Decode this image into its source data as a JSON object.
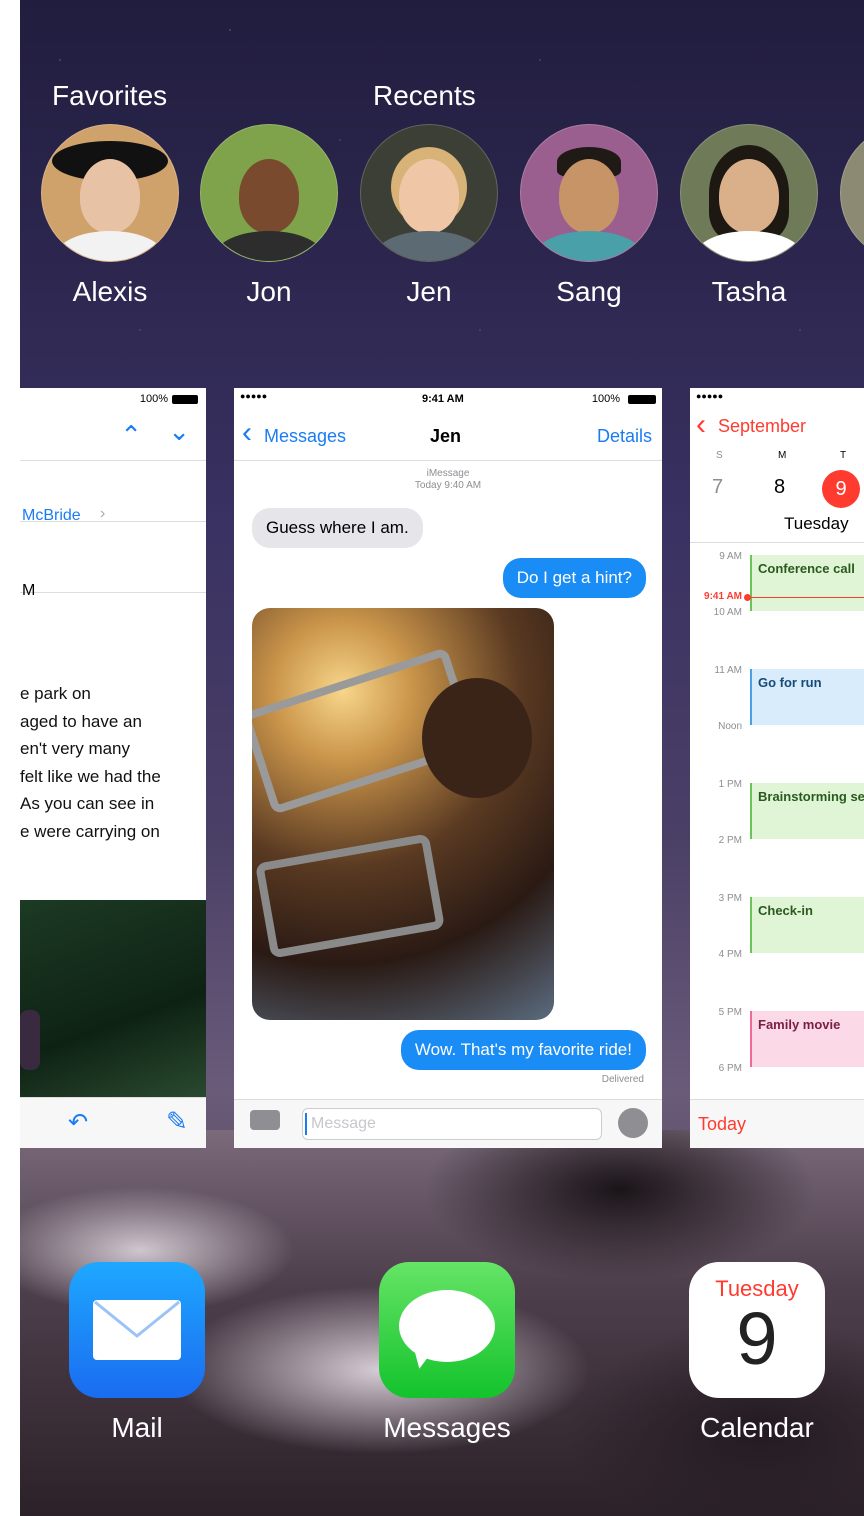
{
  "favorites_label": "Favorites",
  "recents_label": "Recents",
  "contacts": [
    {
      "name": "Alexis",
      "skin": "#e8c2a4",
      "hair": "#b07a3c",
      "bg": "#cfa26c",
      "shirt": "#f2f2f2"
    },
    {
      "name": "Jon",
      "skin": "#7a4a2e",
      "hair": "#2a1a12",
      "bg": "#7ea34a",
      "shirt": "#2d2d2d"
    },
    {
      "name": "Jen",
      "skin": "#efc7a6",
      "hair": "#d9b277",
      "bg": "#3c3f36",
      "shirt": "#5c6a74"
    },
    {
      "name": "Sang",
      "skin": "#c79468",
      "hair": "#1f1a16",
      "bg": "#9a5f8e",
      "shirt": "#4aa0a8"
    },
    {
      "name": "Tasha",
      "skin": "#d9b08a",
      "hair": "#1e1812",
      "bg": "#6f7a58",
      "shirt": "#ffffff"
    }
  ],
  "mail_card": {
    "battery": "100%",
    "sender": "McBride",
    "time_fragment": "M",
    "body_lines": [
      "e park on",
      "aged to have an",
      "en't very many",
      "felt like we had the",
      "As you can see in",
      "e were carrying on"
    ]
  },
  "messages_card": {
    "signal": "●●●●● ",
    "time": "9:41 AM",
    "battery": "100%",
    "back_label": "Messages",
    "title": "Jen",
    "details_label": "Details",
    "imessage_label": "iMessage",
    "timestamp": "Today 9:40 AM",
    "msg1": "Guess where I am.",
    "msg2": "Do I get a hint?",
    "msg3": "Wow. That's my favorite ride!",
    "delivered": "Delivered",
    "input_placeholder": "Message"
  },
  "calendar_card": {
    "signal": "●●●●● ",
    "back_label": "September",
    "weekdays": [
      "S",
      "M",
      "T"
    ],
    "dates": [
      "7",
      "8",
      "9"
    ],
    "day_label": "Tuesday",
    "now_label": "9:41 AM",
    "times": [
      "9 AM",
      "10 AM",
      "11 AM",
      "Noon",
      "1 PM",
      "2 PM",
      "3 PM",
      "4 PM",
      "5 PM",
      "6 PM"
    ],
    "events": [
      "Conference call",
      "Go for run",
      "Brainstorming session",
      "Check-in",
      "Family movie"
    ],
    "today_label": "Today"
  },
  "dock": {
    "mail_label": "Mail",
    "messages_label": "Messages",
    "calendar_label": "Calendar",
    "calendar_day": "Tuesday",
    "calendar_date": "9"
  },
  "colors": {
    "ios_blue": "#1a7cf5",
    "ios_red": "#ff3b30",
    "event_green": "#dff5d6",
    "event_blue": "#d8ecfb",
    "event_pink": "#fbd9e6"
  }
}
